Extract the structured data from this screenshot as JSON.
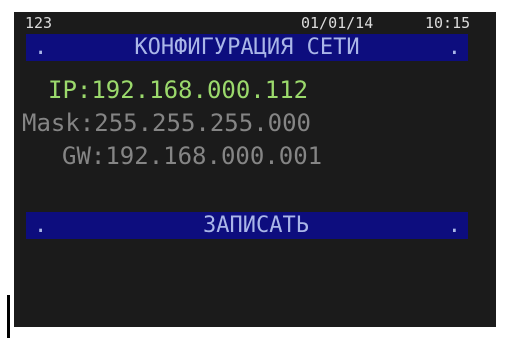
{
  "status": {
    "left": "123",
    "date": "01/01/14",
    "time": "10:15"
  },
  "title_bar": {
    "dot_left": ".",
    "title": "КОНФИГУРАЦИЯ СЕТИ",
    "dot_right": "."
  },
  "network": {
    "ip": {
      "label": "IP:",
      "value": "192.168.000.112",
      "color": "#9bd96c"
    },
    "mask": {
      "label": "Mask:",
      "value": "255.255.255.000"
    },
    "gw": {
      "label": "GW:",
      "value": "192.168.000.001"
    }
  },
  "save_bar": {
    "dot_left": ".",
    "label": "ЗАПИСАТЬ",
    "dot_right": "."
  },
  "colors": {
    "bar_background": "#0d0d7e",
    "screen_background": "#1b1b1b",
    "selected": "#9bd96c",
    "normal": "#858585"
  }
}
